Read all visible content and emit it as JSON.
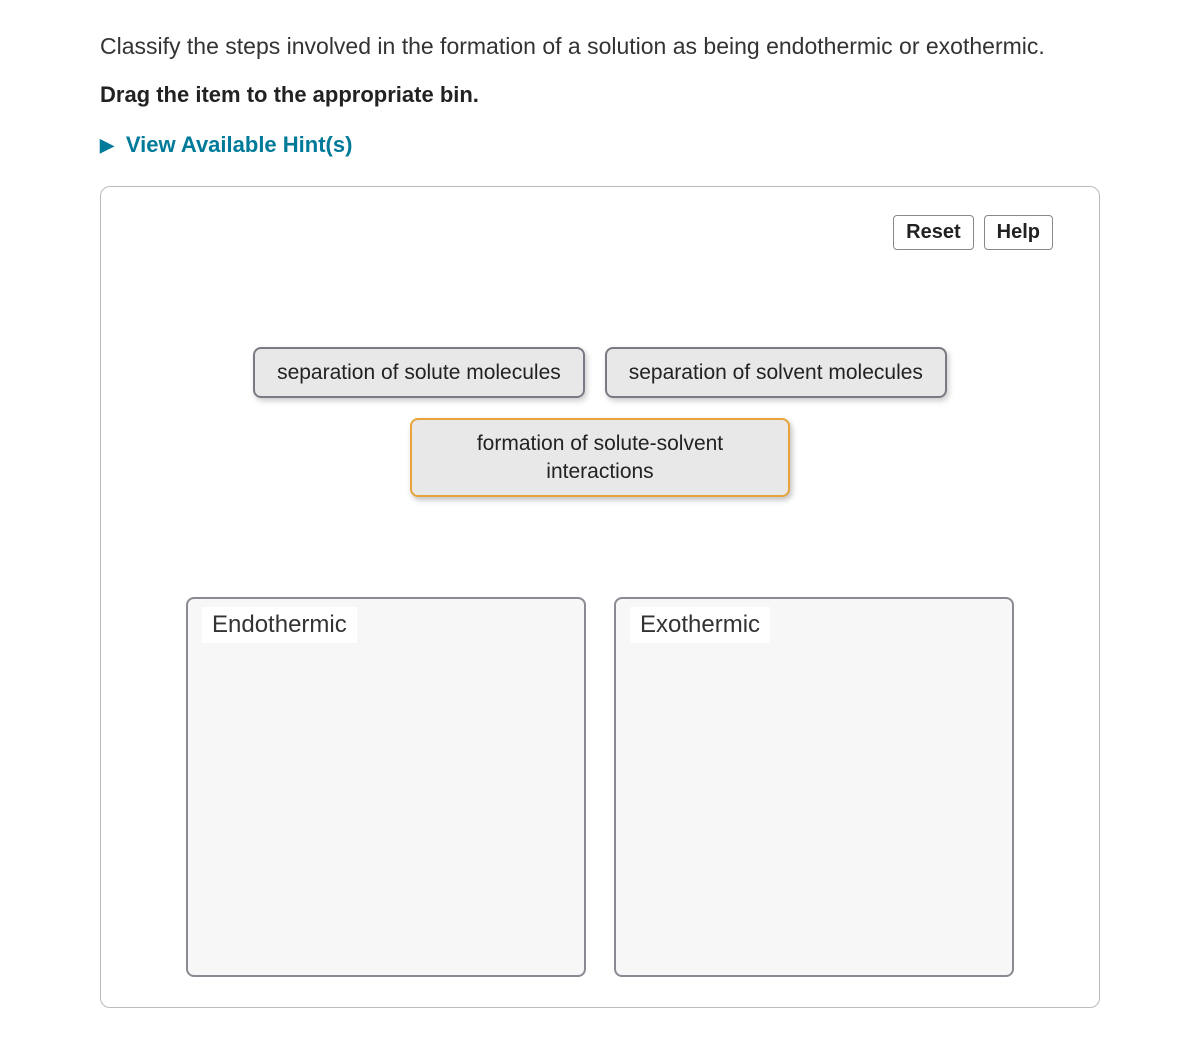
{
  "question": "Classify the steps involved in the formation of a solution as being endothermic or exothermic.",
  "instruction": "Drag the item to the appropriate bin.",
  "hints": {
    "label": "View Available Hint(s)"
  },
  "toolbar": {
    "reset": "Reset",
    "help": "Help"
  },
  "dragItems": {
    "item1": "separation of solute molecules",
    "item2": "separation of solvent molecules",
    "item3": "formation of solute-solvent interactions"
  },
  "bins": {
    "bin1": "Endothermic",
    "bin2": "Exothermic"
  }
}
